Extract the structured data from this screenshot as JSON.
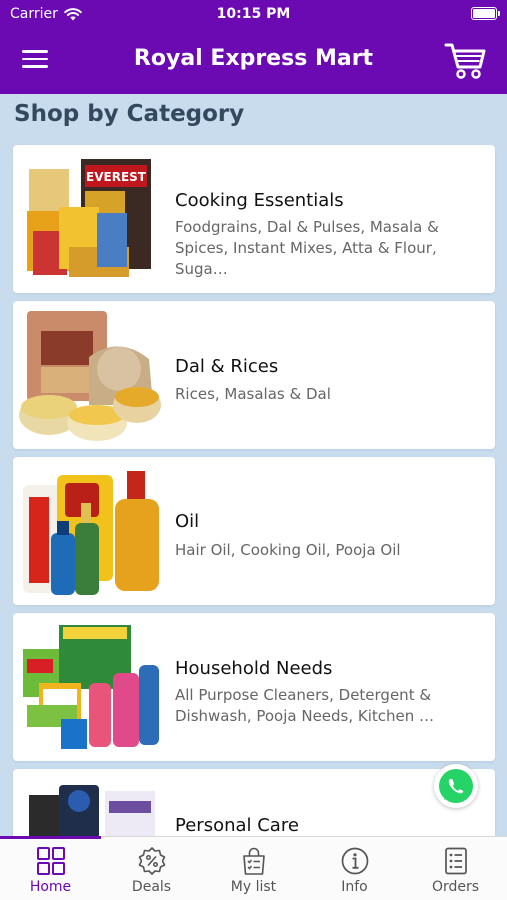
{
  "status": {
    "carrier": "Carrier",
    "time": "10:15 PM"
  },
  "header": {
    "title": "Royal Express Mart",
    "cart_icon": "cart-icon",
    "menu_icon": "menu-icon"
  },
  "section": {
    "title": "Shop by Category"
  },
  "categories": [
    {
      "name": "Cooking Essentials",
      "subtitle": "Foodgrains, Dal & Pulses, Masala & Spices, Instant Mixes, Atta & Flour, Suga…"
    },
    {
      "name": "Dal & Rices",
      "subtitle": "Rices, Masalas & Dal"
    },
    {
      "name": "Oil",
      "subtitle": "Hair Oil, Cooking Oil, Pooja Oil"
    },
    {
      "name": "Household Needs",
      "subtitle": "All Purpose Cleaners, Detergent & Dishwash, Pooja Needs, Kitchen …"
    },
    {
      "name": "Personal Care",
      "subtitle": ""
    }
  ],
  "tabs": [
    {
      "label": "Home",
      "icon": "grid-icon",
      "active": true
    },
    {
      "label": "Deals",
      "icon": "discount-icon"
    },
    {
      "label": "My list",
      "icon": "shopping-bag-list-icon"
    },
    {
      "label": "Info",
      "icon": "info-icon"
    },
    {
      "label": "Orders",
      "icon": "orders-list-icon"
    }
  ],
  "colors": {
    "primary": "#6b0ab3",
    "background": "#c8dcee",
    "whatsapp": "#25d366"
  }
}
